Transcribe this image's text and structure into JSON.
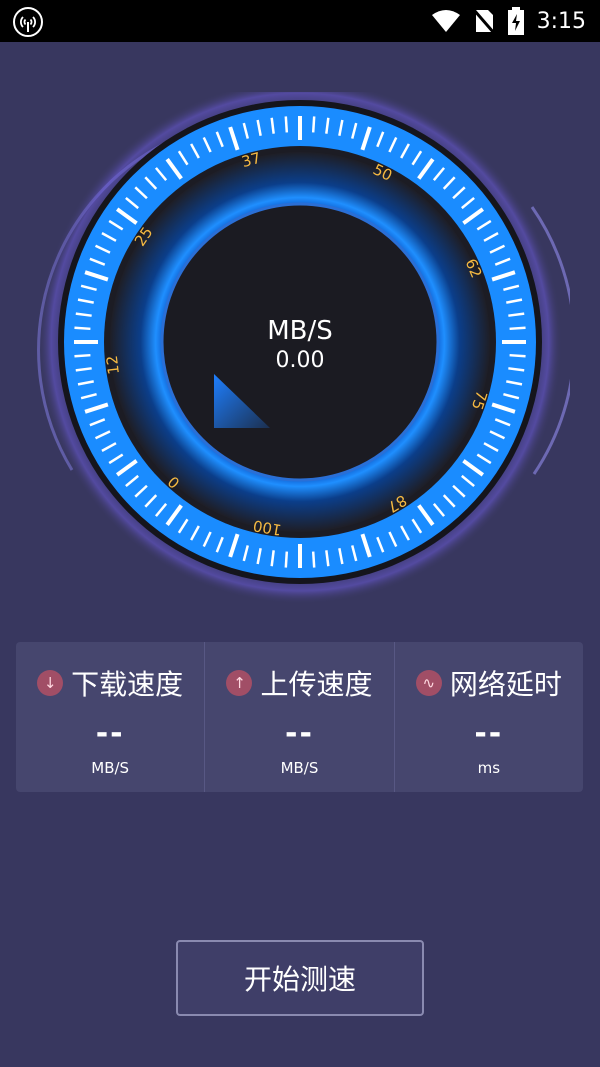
{
  "status_bar": {
    "time": "3:15",
    "icons": [
      "cell-broadcast-icon",
      "wifi-icon",
      "no-sim-icon",
      "battery-charging-icon"
    ]
  },
  "gauge": {
    "unit": "MB/S",
    "value": "0.00",
    "ticks": [
      "0",
      "12",
      "25",
      "37",
      "50",
      "62",
      "75",
      "87",
      "100"
    ],
    "level": 0,
    "colors": {
      "ring": "#1a8cff",
      "ticklabel": "#f5b942",
      "dial": "#1c1c24"
    }
  },
  "stats": [
    {
      "icon": "download-icon",
      "icon_glyph": "↓",
      "label": "下载速度",
      "value": "--",
      "unit": "MB/S"
    },
    {
      "icon": "upload-icon",
      "icon_glyph": "↑",
      "label": "上传速度",
      "value": "--",
      "unit": "MB/S"
    },
    {
      "icon": "latency-icon",
      "icon_glyph": "∿",
      "label": "网络延时",
      "value": "--",
      "unit": "ms"
    }
  ],
  "start_button": {
    "label": "开始测速"
  },
  "colors": {
    "background": "#38375f",
    "card": "#46466e",
    "icon_badge": "#a14e66"
  }
}
